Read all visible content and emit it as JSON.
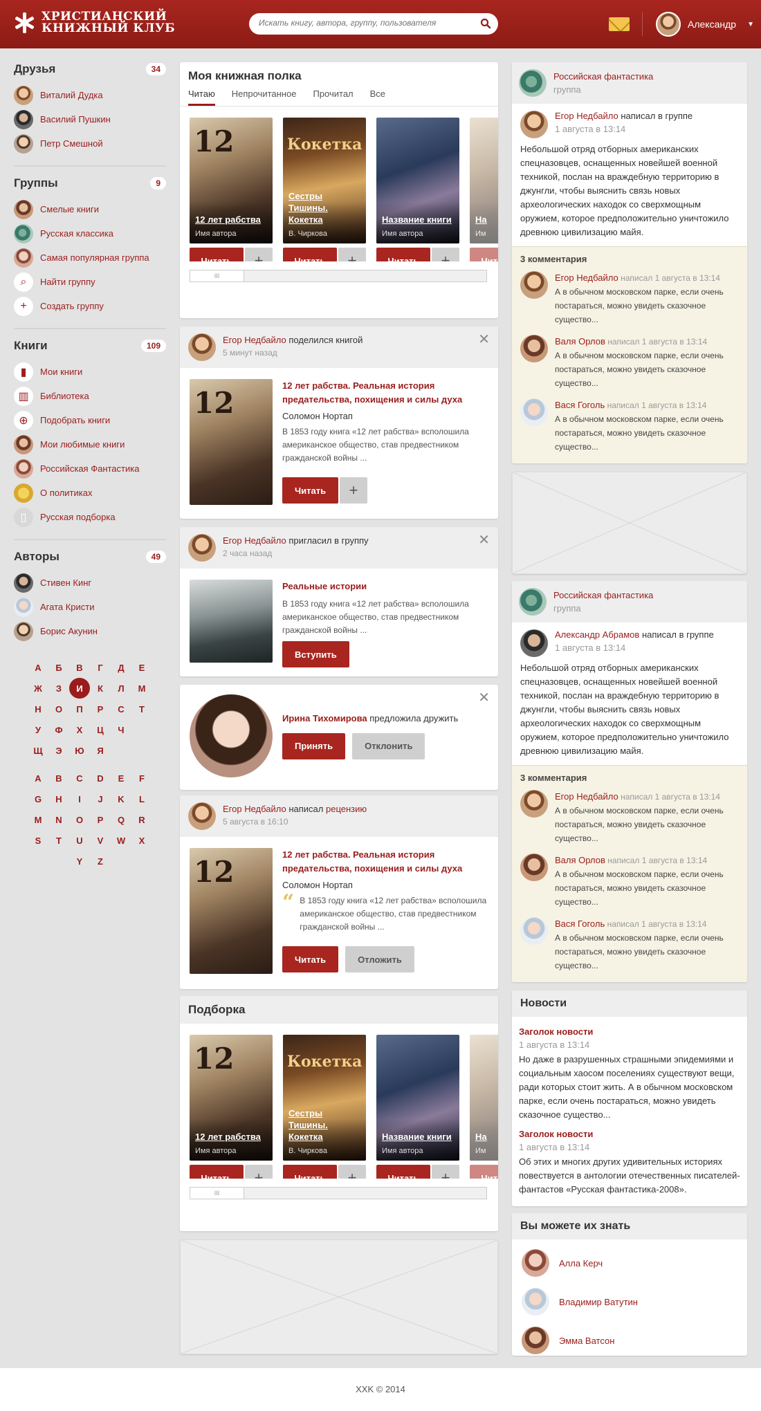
{
  "header": {
    "logo_line1": "ХРИСТИАНСКИЙ",
    "logo_line2": "КНИЖНЫЙ КЛУБ",
    "search_placeholder": "Искать книгу, автора, группу, пользователя",
    "user_name": "Александр",
    "accent": "#a8261f"
  },
  "sidebar": {
    "friends": {
      "title": "Друзья",
      "count": "34",
      "items": [
        "Виталий Дудка",
        "Василий Пушкин",
        "Петр Смешной"
      ]
    },
    "groups": {
      "title": "Группы",
      "count": "9",
      "items": [
        "Смелые книги",
        "Русская классика",
        "Самая популярная группа",
        "Найти группу",
        "Создать группу"
      ]
    },
    "books": {
      "title": "Книги",
      "count": "109",
      "items": [
        "Мои книги",
        "Библиотека",
        "Подобрать книги",
        "Мои любимые книги",
        "Российская Фантастика",
        "О политиках",
        "Русская подборка"
      ]
    },
    "authors": {
      "title": "Авторы",
      "count": "49",
      "items": [
        "Стивен Кинг",
        "Агата Кристи",
        "Борис Акунин"
      ]
    },
    "alphabet_ru": [
      "А",
      "Б",
      "В",
      "Г",
      "Д",
      "Е",
      "Ж",
      "З",
      "И",
      "К",
      "Л",
      "М",
      "Н",
      "О",
      "П",
      "Р",
      "С",
      "Т",
      "У",
      "Ф",
      "Х",
      "Ц",
      "Ч",
      "Щ",
      "Э",
      "Ю",
      "Я"
    ],
    "alphabet_en": [
      "A",
      "B",
      "C",
      "D",
      "E",
      "F",
      "G",
      "H",
      "I",
      "J",
      "K",
      "L",
      "M",
      "N",
      "O",
      "P",
      "Q",
      "R",
      "S",
      "T",
      "U",
      "V",
      "W",
      "X",
      "Y",
      "Z"
    ],
    "active_letter": "И"
  },
  "shelf": {
    "title": "Моя книжная полка",
    "tabs": [
      "Читаю",
      "Непрочитанное",
      "Прочитал",
      "Все"
    ],
    "active_tab": "Читаю",
    "books": [
      {
        "title": "12 лет рабства",
        "author": "Имя автора"
      },
      {
        "title": "Сестры Тишины. Кокетка",
        "author": "В. Чиркова"
      },
      {
        "title": "Название книги",
        "author": "Имя автора"
      },
      {
        "title": "На",
        "author": "Им"
      }
    ],
    "read_label": "Читать",
    "plus_label": "+",
    "scroll_thumb": "III"
  },
  "feed": [
    {
      "author": "Егор Недбайло",
      "action": "поделился книгой",
      "time": "5 минут назад",
      "book_title": "12 лет рабства. Реальная история предательства, похищения и силы духа",
      "book_author": "Соломон Нортап",
      "desc": "В 1853 году книга «12 лет рабства» всполошила американское общество, став предвестником гражданской войны ...",
      "button": "Читать"
    },
    {
      "author": "Егор Недбайло",
      "action": "пригласил в группу",
      "time": "2 часа назад",
      "group_title": "Реальные истории",
      "desc": "В 1853 году книга «12 лет рабства» всполошила американское общество, став предвестником гражданской войны ...",
      "button": "Вступить"
    },
    {
      "author": "Ирина Тихомирова",
      "action": "предложила дружить",
      "accept": "Принять",
      "decline": "Отклонить"
    },
    {
      "author": "Егор Недбайло",
      "action": "написал",
      "action_link": "рецензию",
      "time": "5 августа в 16:10",
      "book_title": "12 лет рабства. Реальная история предательства, похищения и силы духа",
      "book_author": "Соломон Нортап",
      "desc": "В 1853 году книга «12 лет рабства» всполошила американское общество, став предвестником гражданской войны ...",
      "button": "Читать",
      "button2": "Отложить"
    }
  ],
  "collection": {
    "title": "Подборка",
    "books": [
      {
        "title": "12 лет рабства",
        "author": "Имя автора"
      },
      {
        "title": "Сестры Тишины. Кокетка",
        "author": "В. Чиркова"
      },
      {
        "title": "Название книги",
        "author": "Имя автора"
      },
      {
        "title": "На",
        "author": "Им"
      }
    ]
  },
  "right": {
    "groups": [
      {
        "name": "Российская фантастика",
        "sub": "группа",
        "poster": "Егор Недбайло",
        "action": "написал в группе",
        "date": "1 августа в 13:14",
        "text": "Небольшой отряд отборных американских спецназовцев, оснащенных новейшей военной техникой, послан на враждебную территорию в джунгли, чтобы выяснить связь новых археологических находок со сверхмощным оружием, которое предположительно уничтожило древнюю цивилизацию майя."
      },
      {
        "name": "Российская фантастика",
        "sub": "группа",
        "poster": "Александр Абрамов",
        "action": "написал в группе",
        "date": "1 августа в 13:14",
        "text": "Небольшой отряд отборных американских спецназовцев, оснащенных новейшей военной техникой, послан на враждебную территорию в джунгли, чтобы выяснить связь новых археологических находок со сверхмощным оружием, которое предположительно уничтожило древнюю цивилизацию майя."
      }
    ],
    "comments_title": "3 комментария",
    "comments": [
      {
        "who": "Егор Недбайло",
        "when": "написал 1 августа в 13:14",
        "text": "А в обычном московском парке, если очень постараться, можно увидеть сказочное существо..."
      },
      {
        "who": "Валя Орлов",
        "when": "написал 1 августа в 13:14",
        "text": "А в обычном московском парке, если очень постараться, можно увидеть сказочное существо..."
      },
      {
        "who": "Вася Гоголь",
        "when": "написал 1 августа в 13:14",
        "text": "А в обычном московском парке, если очень постараться, можно увидеть сказочное существо..."
      }
    ],
    "news": {
      "title": "Новости",
      "items": [
        {
          "title": "Заголок новости",
          "date": "1 августа в 13:14",
          "text": "Но даже в разрушенных страшными эпидемиями и социальным хаосом поселениях существуют вещи, ради которых стоит жить. А в обычном московском парке, если очень постараться, можно увидеть сказочное существо..."
        },
        {
          "title": "Заголок новости",
          "date": "1 августа в 13:14",
          "text": "Об этих и многих других удивительных историях повествуется в антологии отечественных писателей-фантастов «Русская фантастика-2008»."
        }
      ]
    },
    "know": {
      "title": "Вы можете их знать",
      "people": [
        "Алла Керч",
        "Владимир Ватутин",
        "Эмма Ватсон"
      ]
    }
  },
  "footer": "XXK © 2014"
}
